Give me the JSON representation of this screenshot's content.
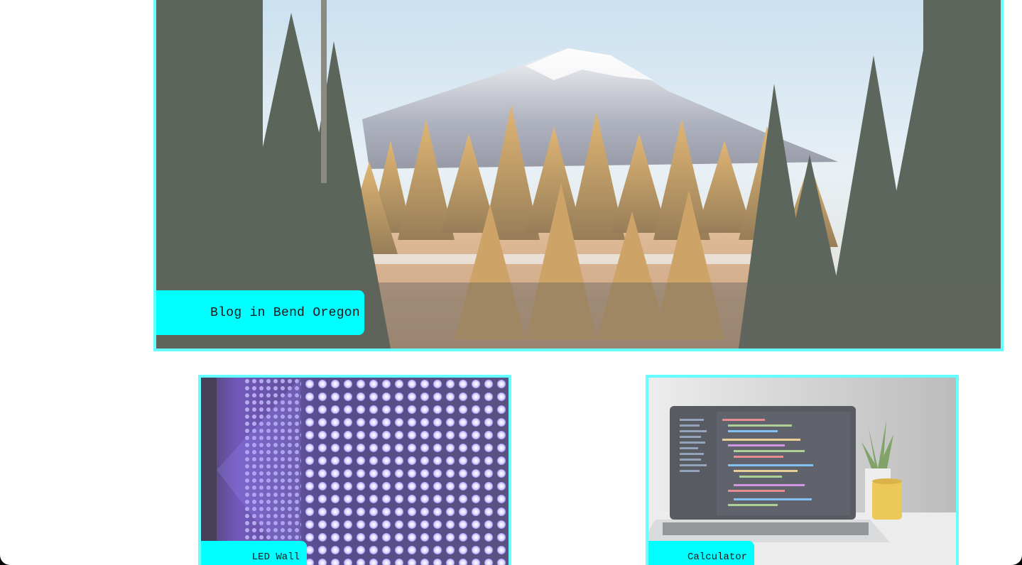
{
  "projects": {
    "featured": {
      "label": "Blog in Bend Oregon",
      "image": "mountain-forest-photo"
    },
    "cards": [
      {
        "label": "LED Wall",
        "image": "led-wall-photo"
      },
      {
        "label": "Calculator",
        "image": "laptop-code-photo"
      }
    ]
  },
  "colors": {
    "accent": "#00ffff",
    "border": "#66ffff",
    "background": "#ffffff"
  }
}
